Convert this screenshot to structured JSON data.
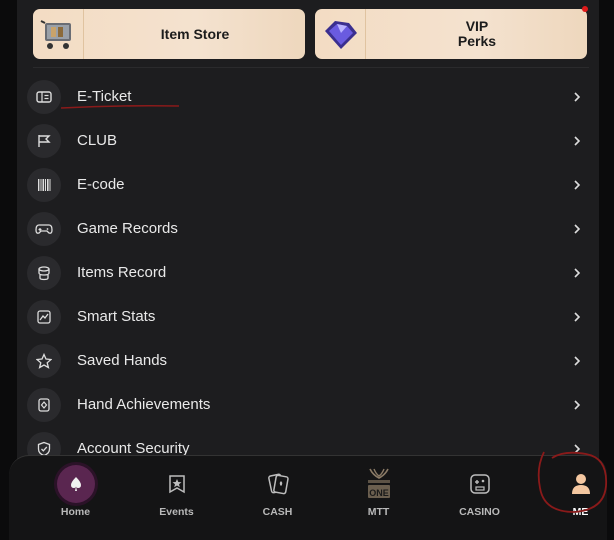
{
  "top_cards": {
    "left_label": "Item Store",
    "right_label_line1": "VIP",
    "right_label_line2": "Perks"
  },
  "menu": {
    "items": [
      {
        "label": "E-Ticket",
        "icon": "ticket-icon"
      },
      {
        "label": "CLUB",
        "icon": "flag-icon"
      },
      {
        "label": "E-code",
        "icon": "barcode-icon"
      },
      {
        "label": "Game Records",
        "icon": "gamepad-icon"
      },
      {
        "label": "Items Record",
        "icon": "stack-icon"
      },
      {
        "label": "Smart Stats",
        "icon": "chart-icon"
      },
      {
        "label": "Saved Hands",
        "icon": "star-icon"
      },
      {
        "label": "Hand Achievements",
        "icon": "trophy-icon"
      },
      {
        "label": "Account Security",
        "icon": "shield-check-icon"
      }
    ]
  },
  "nav": {
    "items": [
      {
        "label": "Home",
        "icon": "spade-icon"
      },
      {
        "label": "Events",
        "icon": "events-icon"
      },
      {
        "label": "CASH",
        "icon": "cards-icon"
      },
      {
        "label": "MTT",
        "icon": "mtt-icon"
      },
      {
        "label": "CASINO",
        "icon": "casino-icon"
      },
      {
        "label": "ME",
        "icon": "user-icon"
      }
    ],
    "active": "ME"
  },
  "colors": {
    "accent": "#f3dcc3",
    "background": "#1d1d1f",
    "annotation": "#8a1a1a"
  }
}
